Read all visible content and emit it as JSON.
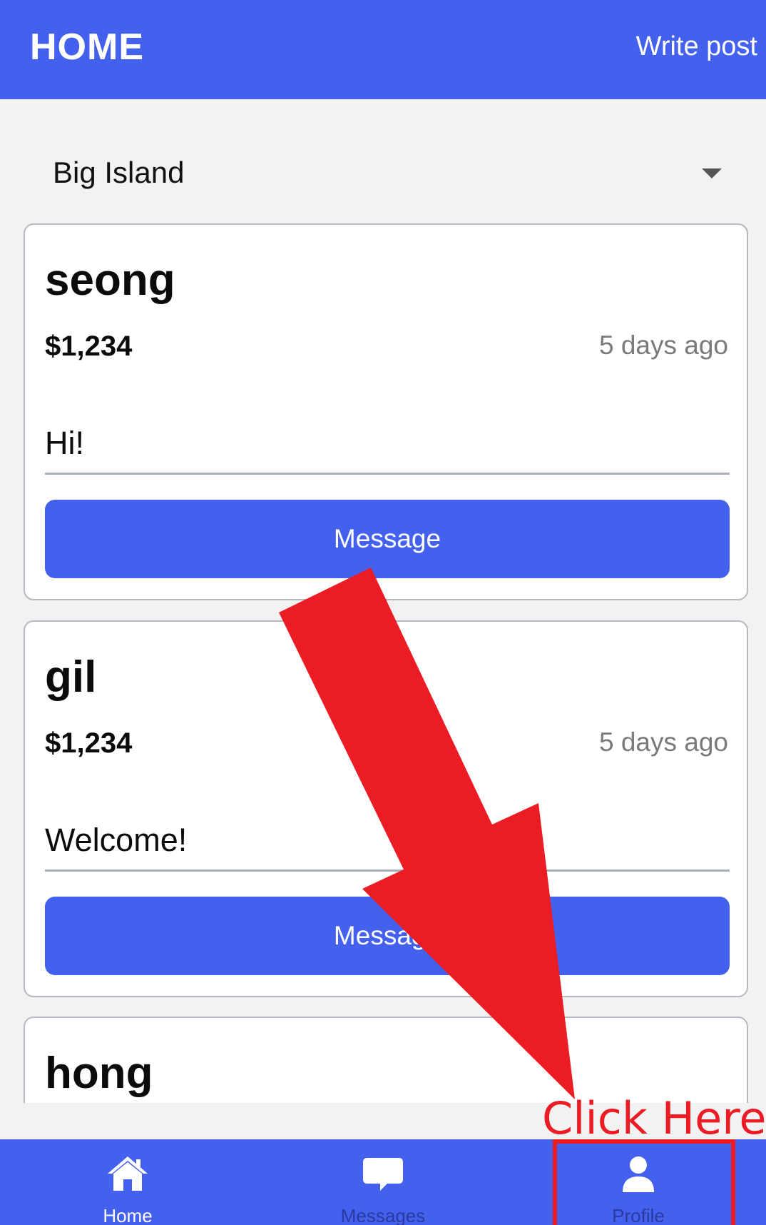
{
  "header": {
    "title": "HOME",
    "action_label": "Write post"
  },
  "region_select": {
    "value": "Big Island"
  },
  "posts": [
    {
      "user": "seong",
      "price": "$1,234",
      "time": "5 days ago",
      "text": "Hi!",
      "button_label": "Message"
    },
    {
      "user": "gil",
      "price": "$1,234",
      "time": "5 days ago",
      "text": "Welcome!",
      "button_label": "Message"
    },
    {
      "user": "hong",
      "price": "",
      "time": "",
      "text": "",
      "button_label": ""
    }
  ],
  "tabbar": {
    "tabs": [
      {
        "label": "Home",
        "icon": "home-icon",
        "active": true
      },
      {
        "label": "Messages",
        "icon": "chat-bubble-icon",
        "active": false
      },
      {
        "label": "Profile",
        "icon": "user-icon",
        "active": false
      }
    ]
  },
  "annotation": {
    "text": "Click Here!"
  },
  "colors": {
    "primary": "#4461ee",
    "background": "#f2f2f2",
    "annotation": "#ec1c24",
    "muted_text": "#7a7a7a",
    "inactive_tab_label": "#2a3aa0"
  }
}
